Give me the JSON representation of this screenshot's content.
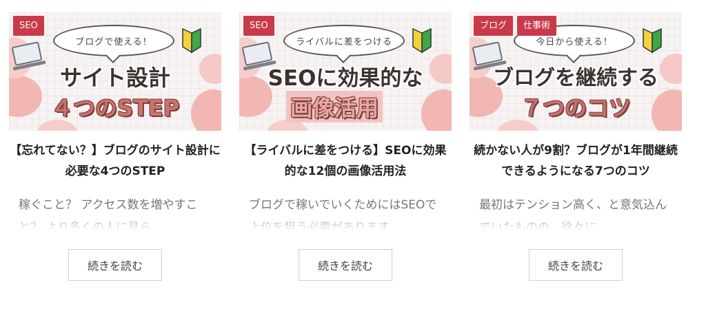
{
  "cards": [
    {
      "tags": [
        "SEO"
      ],
      "thumb": {
        "bubble": "ブログで使える！",
        "line1": "サイト設計",
        "line2": "４つのSTEP"
      },
      "title": "【忘れてない？】ブログのサイト設計に必要な4つのSTEP",
      "excerpt": "稼ぐこと？ アクセス数を増やすこと？ より多くの人に見ら",
      "button": "続きを読む"
    },
    {
      "tags": [
        "SEO"
      ],
      "thumb": {
        "bubble": "ライバルに差をつける",
        "line1": "SEOに効果的な",
        "line2": "画像活用"
      },
      "title": "【ライバルに差をつける】SEOに効果的な12個の画像活用法",
      "excerpt": "ブログで稼いでいくためにはSEOで上位を狙う必要があります",
      "button": "続きを読む"
    },
    {
      "tags": [
        "ブログ",
        "仕事術"
      ],
      "thumb": {
        "bubble": "今日から使える！",
        "line1": "ブログを継続する",
        "line2": "７つのコツ"
      },
      "title": "続かない人が9割？ブログが1年間継続できるようになる7つのコツ",
      "excerpt": "最初はテンション高く、と意気込んでいたものの、徐々に",
      "button": "続きを読む"
    }
  ],
  "colors": {
    "tag": "#c83a4a",
    "accent_pink": "#f2b6b3"
  }
}
